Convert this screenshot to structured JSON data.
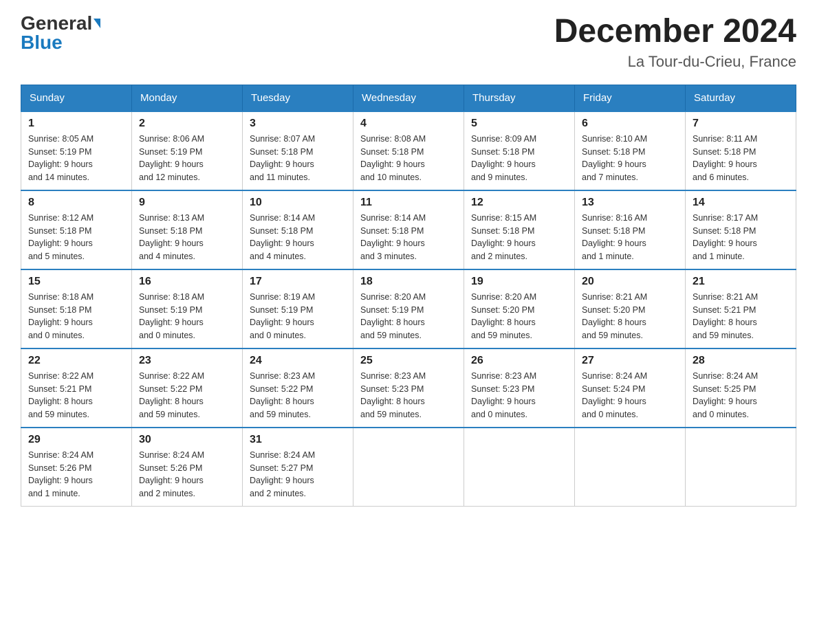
{
  "header": {
    "logo_general": "General",
    "logo_blue": "Blue",
    "month_year": "December 2024",
    "location": "La Tour-du-Crieu, France"
  },
  "days_of_week": [
    "Sunday",
    "Monday",
    "Tuesday",
    "Wednesday",
    "Thursday",
    "Friday",
    "Saturday"
  ],
  "weeks": [
    [
      {
        "day": "1",
        "sunrise": "8:05 AM",
        "sunset": "5:19 PM",
        "daylight": "9 hours and 14 minutes."
      },
      {
        "day": "2",
        "sunrise": "8:06 AM",
        "sunset": "5:19 PM",
        "daylight": "9 hours and 12 minutes."
      },
      {
        "day": "3",
        "sunrise": "8:07 AM",
        "sunset": "5:18 PM",
        "daylight": "9 hours and 11 minutes."
      },
      {
        "day": "4",
        "sunrise": "8:08 AM",
        "sunset": "5:18 PM",
        "daylight": "9 hours and 10 minutes."
      },
      {
        "day": "5",
        "sunrise": "8:09 AM",
        "sunset": "5:18 PM",
        "daylight": "9 hours and 9 minutes."
      },
      {
        "day": "6",
        "sunrise": "8:10 AM",
        "sunset": "5:18 PM",
        "daylight": "9 hours and 7 minutes."
      },
      {
        "day": "7",
        "sunrise": "8:11 AM",
        "sunset": "5:18 PM",
        "daylight": "9 hours and 6 minutes."
      }
    ],
    [
      {
        "day": "8",
        "sunrise": "8:12 AM",
        "sunset": "5:18 PM",
        "daylight": "9 hours and 5 minutes."
      },
      {
        "day": "9",
        "sunrise": "8:13 AM",
        "sunset": "5:18 PM",
        "daylight": "9 hours and 4 minutes."
      },
      {
        "day": "10",
        "sunrise": "8:14 AM",
        "sunset": "5:18 PM",
        "daylight": "9 hours and 4 minutes."
      },
      {
        "day": "11",
        "sunrise": "8:14 AM",
        "sunset": "5:18 PM",
        "daylight": "9 hours and 3 minutes."
      },
      {
        "day": "12",
        "sunrise": "8:15 AM",
        "sunset": "5:18 PM",
        "daylight": "9 hours and 2 minutes."
      },
      {
        "day": "13",
        "sunrise": "8:16 AM",
        "sunset": "5:18 PM",
        "daylight": "9 hours and 1 minute."
      },
      {
        "day": "14",
        "sunrise": "8:17 AM",
        "sunset": "5:18 PM",
        "daylight": "9 hours and 1 minute."
      }
    ],
    [
      {
        "day": "15",
        "sunrise": "8:18 AM",
        "sunset": "5:18 PM",
        "daylight": "9 hours and 0 minutes."
      },
      {
        "day": "16",
        "sunrise": "8:18 AM",
        "sunset": "5:19 PM",
        "daylight": "9 hours and 0 minutes."
      },
      {
        "day": "17",
        "sunrise": "8:19 AM",
        "sunset": "5:19 PM",
        "daylight": "9 hours and 0 minutes."
      },
      {
        "day": "18",
        "sunrise": "8:20 AM",
        "sunset": "5:19 PM",
        "daylight": "8 hours and 59 minutes."
      },
      {
        "day": "19",
        "sunrise": "8:20 AM",
        "sunset": "5:20 PM",
        "daylight": "8 hours and 59 minutes."
      },
      {
        "day": "20",
        "sunrise": "8:21 AM",
        "sunset": "5:20 PM",
        "daylight": "8 hours and 59 minutes."
      },
      {
        "day": "21",
        "sunrise": "8:21 AM",
        "sunset": "5:21 PM",
        "daylight": "8 hours and 59 minutes."
      }
    ],
    [
      {
        "day": "22",
        "sunrise": "8:22 AM",
        "sunset": "5:21 PM",
        "daylight": "8 hours and 59 minutes."
      },
      {
        "day": "23",
        "sunrise": "8:22 AM",
        "sunset": "5:22 PM",
        "daylight": "8 hours and 59 minutes."
      },
      {
        "day": "24",
        "sunrise": "8:23 AM",
        "sunset": "5:22 PM",
        "daylight": "8 hours and 59 minutes."
      },
      {
        "day": "25",
        "sunrise": "8:23 AM",
        "sunset": "5:23 PM",
        "daylight": "8 hours and 59 minutes."
      },
      {
        "day": "26",
        "sunrise": "8:23 AM",
        "sunset": "5:23 PM",
        "daylight": "9 hours and 0 minutes."
      },
      {
        "day": "27",
        "sunrise": "8:24 AM",
        "sunset": "5:24 PM",
        "daylight": "9 hours and 0 minutes."
      },
      {
        "day": "28",
        "sunrise": "8:24 AM",
        "sunset": "5:25 PM",
        "daylight": "9 hours and 0 minutes."
      }
    ],
    [
      {
        "day": "29",
        "sunrise": "8:24 AM",
        "sunset": "5:26 PM",
        "daylight": "9 hours and 1 minute."
      },
      {
        "day": "30",
        "sunrise": "8:24 AM",
        "sunset": "5:26 PM",
        "daylight": "9 hours and 2 minutes."
      },
      {
        "day": "31",
        "sunrise": "8:24 AM",
        "sunset": "5:27 PM",
        "daylight": "9 hours and 2 minutes."
      },
      null,
      null,
      null,
      null
    ]
  ],
  "labels": {
    "sunrise": "Sunrise:",
    "sunset": "Sunset:",
    "daylight": "Daylight:"
  }
}
